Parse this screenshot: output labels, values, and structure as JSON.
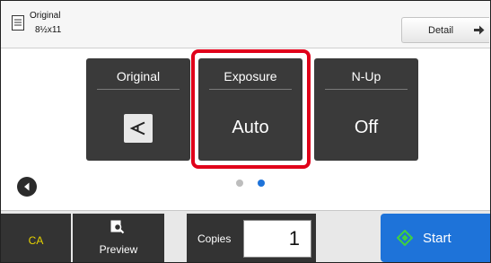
{
  "header": {
    "original_label": "Original",
    "original_size": "8½x11",
    "detail_label": "Detail"
  },
  "settings": [
    {
      "title": "Original",
      "value": "",
      "icon": "page-orientation-icon"
    },
    {
      "title": "Exposure",
      "value": "Auto"
    },
    {
      "title": "N-Up",
      "value": "Off"
    }
  ],
  "pager": {
    "pages": 2,
    "current": 2
  },
  "footer": {
    "ca_label": "CA",
    "preview_label": "Preview",
    "copies_label": "Copies",
    "copies_value": "1",
    "start_label": "Start"
  },
  "colors": {
    "highlight": "#e0001a",
    "start": "#1e73d9",
    "ca_text": "#e8d400",
    "card": "#3a3a3a"
  }
}
